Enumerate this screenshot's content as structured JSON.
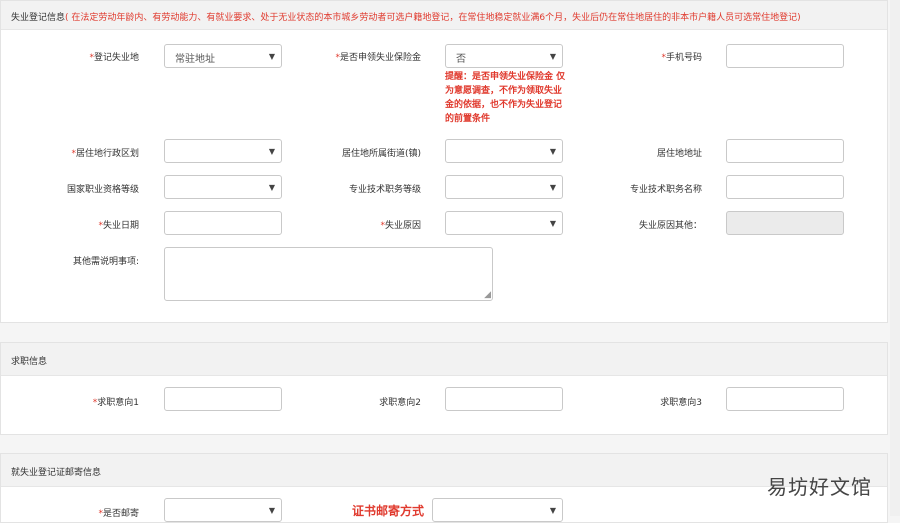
{
  "section1": {
    "title": "失业登记信息",
    "note": "( 在法定劳动年龄内、有劳动能力、有就业要求、处于无业状态的本市城乡劳动者可选户籍地登记，在常住地稳定就业满6个月，失业后仍在常住地居住的非本市户籍人员可选常住地登记)",
    "fields": {
      "reg_place_label": "登记失业地",
      "reg_place_value": "常驻地址",
      "insurance_label": "是否申领失业保险金",
      "insurance_value": "否",
      "phone_label": "手机号码",
      "warning": "提醒：是否申领失业保险金 仅为意愿调查，不作为领取失业金的依据，也不作为失业登记的前置条件",
      "district_label": "居住地行政区划",
      "street_label": "居住地所属街道(镇)",
      "address_label": "居住地地址",
      "cert_label": "国家职业资格等级",
      "tech_level_label": "专业技术职务等级",
      "tech_name_label": "专业技术职务名称",
      "date_label": "失业日期",
      "reason_label": "失业原因",
      "reason_other_label": "失业原因其他：",
      "notes_label": "其他需说明事项:"
    }
  },
  "section2": {
    "title": "求职信息",
    "intent1": "求职意向1",
    "intent2": "求职意向2",
    "intent3": "求职意向3"
  },
  "section3": {
    "title": "就失业登记证邮寄信息",
    "mail_label": "是否邮寄",
    "mail_method": "证书邮寄方式"
  },
  "watermark": "易坊好文馆",
  "colors": {
    "required": "#e03a2e",
    "header_bg": "#f2f2f2"
  }
}
